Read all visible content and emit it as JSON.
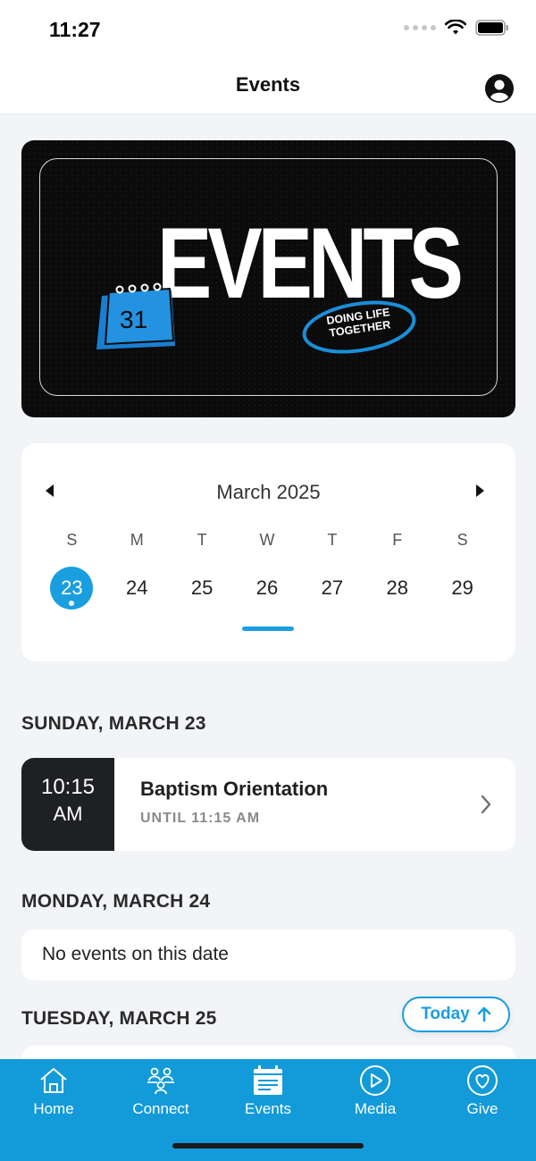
{
  "status_bar": {
    "time": "11:27"
  },
  "header": {
    "title": "Events"
  },
  "banner": {
    "title": "EVENTS",
    "calendar_number": "31",
    "badge_line1": "DOING LIFE",
    "badge_line2": "TOGETHER"
  },
  "calendar": {
    "month": "March 2025",
    "weekdays": [
      "S",
      "M",
      "T",
      "W",
      "T",
      "F",
      "S"
    ],
    "dates": [
      "23",
      "24",
      "25",
      "26",
      "27",
      "28",
      "29"
    ],
    "selected_date": "23"
  },
  "days": [
    {
      "header": "SUNDAY, MARCH 23",
      "event": {
        "time_line1": "10:15",
        "time_line2": "AM",
        "title": "Baptism Orientation",
        "until": "UNTIL 11:15 AM"
      }
    },
    {
      "header": "MONDAY, MARCH 24",
      "empty_text": "No events on this date"
    },
    {
      "header": "TUESDAY, MARCH 25"
    }
  ],
  "today_button": {
    "label": "Today"
  },
  "tabs": [
    {
      "label": "Home",
      "icon": "home-icon"
    },
    {
      "label": "Connect",
      "icon": "people-icon"
    },
    {
      "label": "Events",
      "icon": "calendar-icon"
    },
    {
      "label": "Media",
      "icon": "play-icon"
    },
    {
      "label": "Give",
      "icon": "heart-icon"
    }
  ],
  "colors": {
    "accent": "#1a9ee0",
    "tab_bar": "#129ad9",
    "event_time_block": "#1f2023"
  }
}
